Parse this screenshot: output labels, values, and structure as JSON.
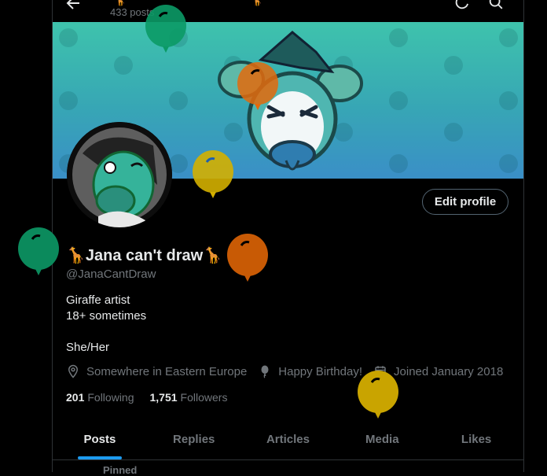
{
  "topbar": {
    "post_count": "433 posts",
    "emoji": "🦒🦒"
  },
  "profile": {
    "edit_button": "Edit profile",
    "display_name": "🦒Jana can't draw🦒",
    "handle": "@JanaCantDraw",
    "bio_lines": [
      "Giraffe artist",
      "18+ sometimes",
      "",
      "She/Her"
    ],
    "location": "Somewhere in Eastern Europe",
    "birthday": "Happy Birthday!",
    "joined": "Joined January 2018",
    "following_count": "201",
    "following_label": "Following",
    "followers_count": "1,751",
    "followers_label": "Followers"
  },
  "tabs": [
    "Posts",
    "Replies",
    "Articles",
    "Media",
    "Likes"
  ],
  "active_tab": "Posts",
  "pinned_label": "Pinned",
  "colors": {
    "accent": "#1d9bf0",
    "balloon_green": "#0b8a5c",
    "balloon_orange": "#d8640e",
    "balloon_yellow": "#c9a400",
    "banner_teal": "#3ec3ac"
  }
}
